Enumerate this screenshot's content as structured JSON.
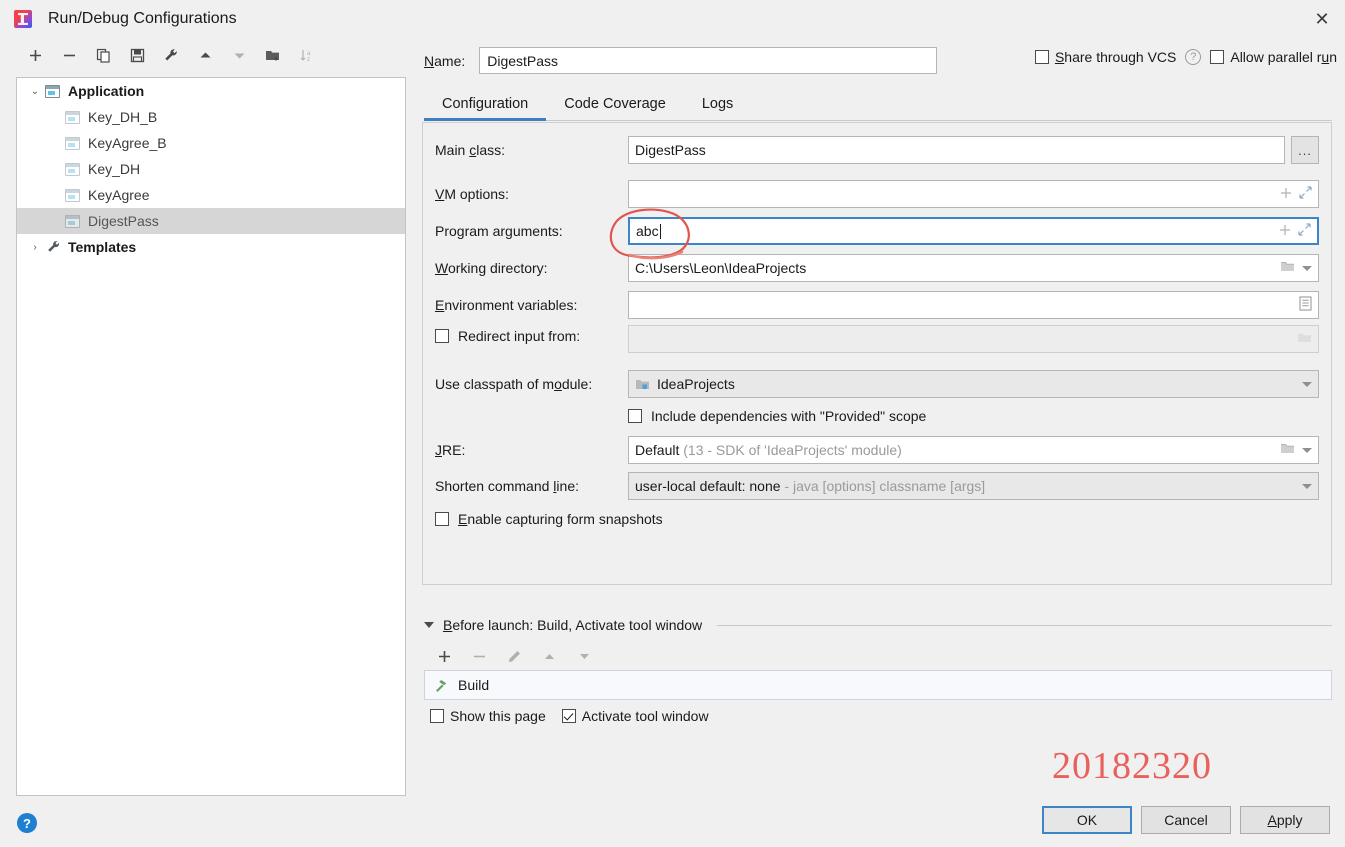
{
  "window": {
    "title": "Run/Debug Configurations",
    "close_label": "✕",
    "app_icon": "intellij-idea-icon"
  },
  "tree_toolbar": [
    {
      "name": "add-configuration-button",
      "icon": "plus-icon",
      "enabled": true
    },
    {
      "name": "remove-configuration-button",
      "icon": "minus-icon",
      "enabled": true
    },
    {
      "name": "copy-configuration-button",
      "icon": "copy-icon",
      "enabled": true
    },
    {
      "name": "save-configuration-button",
      "icon": "save-icon",
      "enabled": true
    },
    {
      "name": "edit-templates-button",
      "icon": "wrench-icon",
      "enabled": true
    },
    {
      "name": "move-up-button",
      "icon": "arrow-up-icon",
      "enabled": true
    },
    {
      "name": "move-down-button",
      "icon": "arrow-down-icon",
      "enabled": false
    },
    {
      "name": "new-folder-button",
      "icon": "folder-add-icon",
      "enabled": true
    },
    {
      "name": "sort-configurations-button",
      "icon": "sort-az-icon",
      "enabled": false
    }
  ],
  "tree": {
    "nodes": [
      {
        "label": "Application",
        "type": "group",
        "expanded": true,
        "arrow": "⌄",
        "icon": "application-icon",
        "selected": false
      },
      {
        "label": "Key_DH_B",
        "type": "child",
        "icon": "application-icon",
        "selected": false
      },
      {
        "label": "KeyAgree_B",
        "type": "child",
        "icon": "application-icon",
        "selected": false
      },
      {
        "label": "Key_DH",
        "type": "child",
        "icon": "application-icon",
        "selected": false
      },
      {
        "label": "KeyAgree",
        "type": "child",
        "icon": "application-icon",
        "selected": false
      },
      {
        "label": "DigestPass",
        "type": "child",
        "icon": "application-icon",
        "selected": true
      },
      {
        "label": "Templates",
        "type": "group",
        "expanded": false,
        "arrow": "›",
        "icon": "wrench-icon",
        "selected": false
      }
    ]
  },
  "name_row": {
    "label": "Name:",
    "label_mnemonic": "N",
    "value": "DigestPass"
  },
  "top_options": {
    "share_label": "Share through VCS",
    "share_checked": false,
    "help_icon": "question-mark-icon",
    "help_glyph": "?",
    "parallel_label": "Allow parallel run",
    "parallel_checked": false
  },
  "tabs": [
    {
      "label": "Configuration",
      "active": true
    },
    {
      "label": "Code Coverage",
      "active": false
    },
    {
      "label": "Logs",
      "active": false
    }
  ],
  "form": {
    "main_class": {
      "label": "Main class:",
      "value": "DigestPass",
      "browse_label": "...",
      "browse_icon": "ellipsis-icon"
    },
    "vm_options": {
      "label": "VM options:",
      "value": "",
      "icons": [
        "plus-icon",
        "expand-icon"
      ]
    },
    "program_arguments": {
      "label": "Program arguments:",
      "value": "abc",
      "focused": true,
      "icons": [
        "plus-icon",
        "expand-icon"
      ]
    },
    "working_directory": {
      "label": "Working directory:",
      "value": "C:\\Users\\Leon\\IdeaProjects",
      "icons": [
        "folder-icon",
        "chevron-down-icon"
      ]
    },
    "environment_variables": {
      "label": "Environment variables:",
      "value": "",
      "icons": [
        "list-edit-icon"
      ]
    },
    "redirect_input": {
      "label": "Redirect input from:",
      "checked": false,
      "value": "",
      "disabled": true,
      "icons": [
        "folder-icon"
      ]
    },
    "classpath_module": {
      "label": "Use classpath of module:",
      "value": "IdeaProjects",
      "icon": "module-icon",
      "icons": [
        "chevron-down-icon"
      ]
    },
    "include_dependencies": {
      "label": "Include dependencies with \"Provided\" scope",
      "checked": false
    },
    "jre": {
      "label": "JRE:",
      "value": "Default",
      "hint": "(13 - SDK of 'IdeaProjects' module)",
      "icons": [
        "folder-icon",
        "chevron-down-icon"
      ]
    },
    "shorten_command_line": {
      "label": "Shorten command line:",
      "value": "user-local default: none",
      "hint": "- java [options] classname [args]",
      "icons": [
        "chevron-down-icon"
      ]
    },
    "form_snapshots": {
      "label": "Enable capturing form snapshots",
      "checked": false
    }
  },
  "before_launch": {
    "header": "Before launch: Build, Activate tool window",
    "expanded": true,
    "toolbar": [
      {
        "name": "add-task-button",
        "icon": "plus-icon",
        "enabled": true
      },
      {
        "name": "remove-task-button",
        "icon": "minus-icon",
        "enabled": false
      },
      {
        "name": "edit-task-button",
        "icon": "pencil-icon",
        "enabled": false
      },
      {
        "name": "task-move-up-button",
        "icon": "arrow-up-icon",
        "enabled": false
      },
      {
        "name": "task-move-down-button",
        "icon": "arrow-down-icon",
        "enabled": false
      }
    ],
    "items": [
      {
        "label": "Build",
        "icon": "hammer-icon"
      }
    ],
    "show_page": {
      "label": "Show this page",
      "checked": false
    },
    "activate_tool_window": {
      "label": "Activate tool window",
      "checked": true
    }
  },
  "annotation": {
    "circle_color": "#e0564f",
    "watermark": "20182320",
    "watermark_color": "#e8615c"
  },
  "footer": {
    "help_glyph": "?",
    "ok": "OK",
    "cancel": "Cancel",
    "apply": "Apply"
  },
  "colors": {
    "accent": "#3d7ebf",
    "focus_border": "#3d85c6",
    "selection": "#d6d6d6",
    "panel_bg": "#f0f0f0"
  }
}
